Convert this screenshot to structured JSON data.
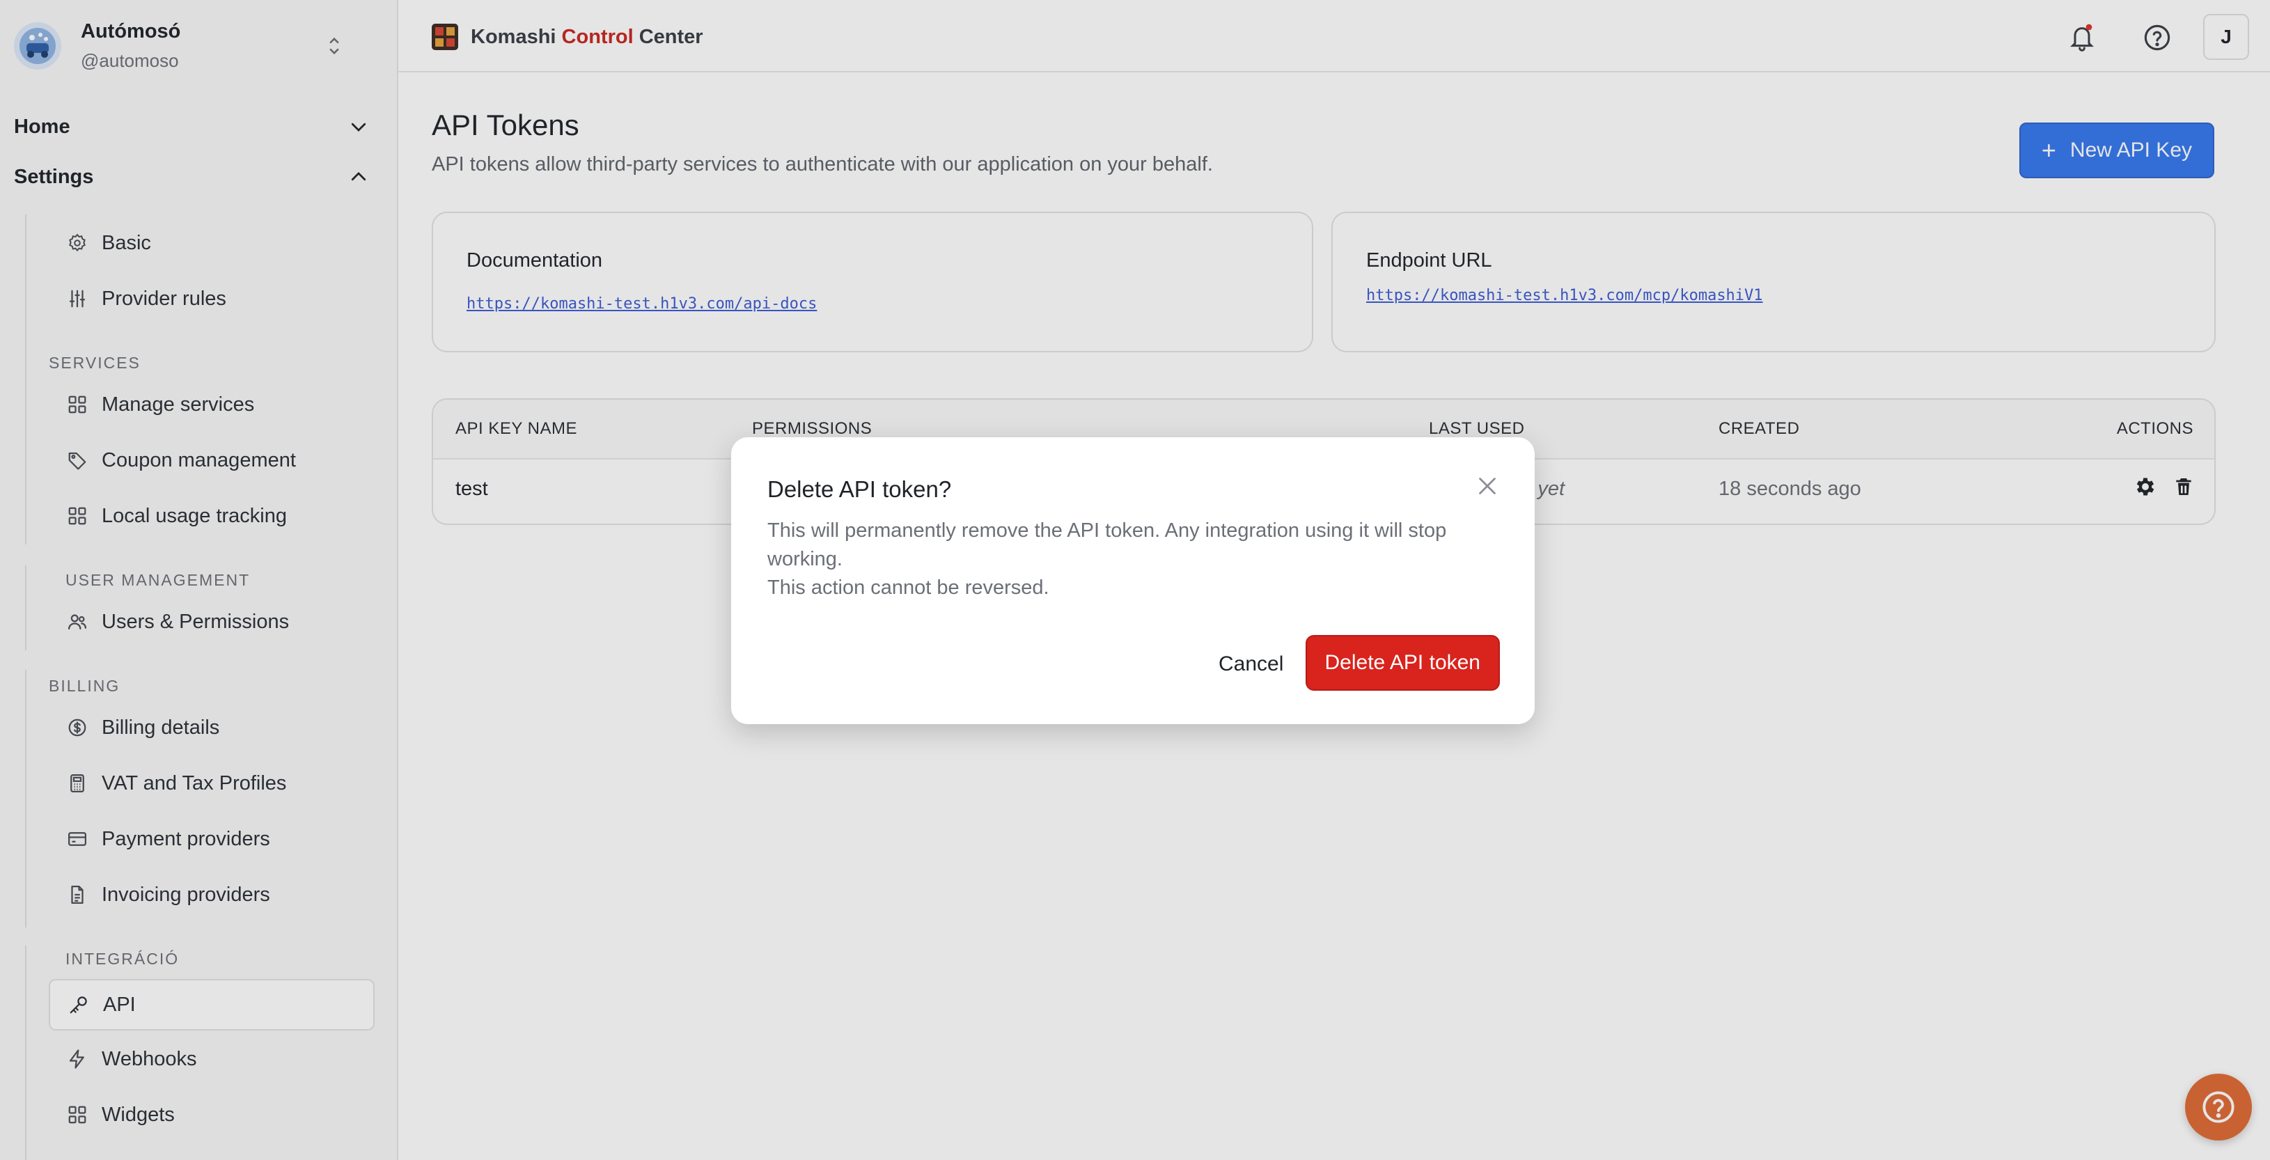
{
  "org": {
    "name": "Autómosó",
    "handle": "@automoso"
  },
  "nav": {
    "home": "Home",
    "settings": "Settings",
    "settings_items": [
      {
        "label": "Basic",
        "icon": "gear-icon"
      },
      {
        "label": "Provider rules",
        "icon": "sliders-icon"
      }
    ],
    "services_label": "SERVICES",
    "services_items": [
      {
        "label": "Manage services",
        "icon": "grid-icon"
      },
      {
        "label": "Coupon management",
        "icon": "tag-icon"
      },
      {
        "label": "Local usage tracking",
        "icon": "grid-icon"
      }
    ],
    "user_management_label": "USER MANAGEMENT",
    "user_management_items": [
      {
        "label": "Users & Permissions",
        "icon": "users-icon"
      }
    ],
    "billing_label": "BILLING",
    "billing_items": [
      {
        "label": "Billing details",
        "icon": "dollar-circle-icon"
      },
      {
        "label": "VAT and Tax Profiles",
        "icon": "calculator-icon"
      },
      {
        "label": "Payment providers",
        "icon": "credit-card-icon"
      },
      {
        "label": "Invoicing providers",
        "icon": "document-icon"
      }
    ],
    "integration_label": "INTEGRÁCIÓ",
    "integration_items": [
      {
        "label": "API",
        "icon": "key-icon",
        "active": true
      },
      {
        "label": "Webhooks",
        "icon": "bolt-icon"
      },
      {
        "label": "Widgets",
        "icon": "grid-icon"
      }
    ]
  },
  "brand": {
    "part1": "Komashi",
    "accent": "Control",
    "part2": "Center"
  },
  "header": {
    "avatar_initial": "J"
  },
  "page": {
    "title": "API Tokens",
    "subtitle": "API tokens allow third-party services to authenticate with our application on your behalf.",
    "new_button": "New API Key"
  },
  "cards": {
    "documentation": {
      "title": "Documentation",
      "link": "https://komashi-test.h1v3.com/api-docs"
    },
    "endpoint": {
      "title": "Endpoint URL",
      "link": "https://komashi-test.h1v3.com/mcp/komashiV1"
    }
  },
  "table": {
    "headers": {
      "name": "API KEY NAME",
      "permissions": "PERMISSIONS",
      "last_used": "LAST USED",
      "created": "CREATED",
      "actions": "ACTIONS"
    },
    "rows": [
      {
        "name": "test",
        "last_used": "Never used yet",
        "created": "18 seconds ago"
      }
    ]
  },
  "modal": {
    "title": "Delete API token?",
    "body_line1": "This will permanently remove the API token. Any integration using it will stop working.",
    "body_line2": "This action cannot be reversed.",
    "cancel": "Cancel",
    "confirm": "Delete API token"
  },
  "colors": {
    "primary": "#3578f0",
    "danger": "#d9231d",
    "brand_accent": "#c9261f",
    "help_fab": "#e06a35"
  }
}
